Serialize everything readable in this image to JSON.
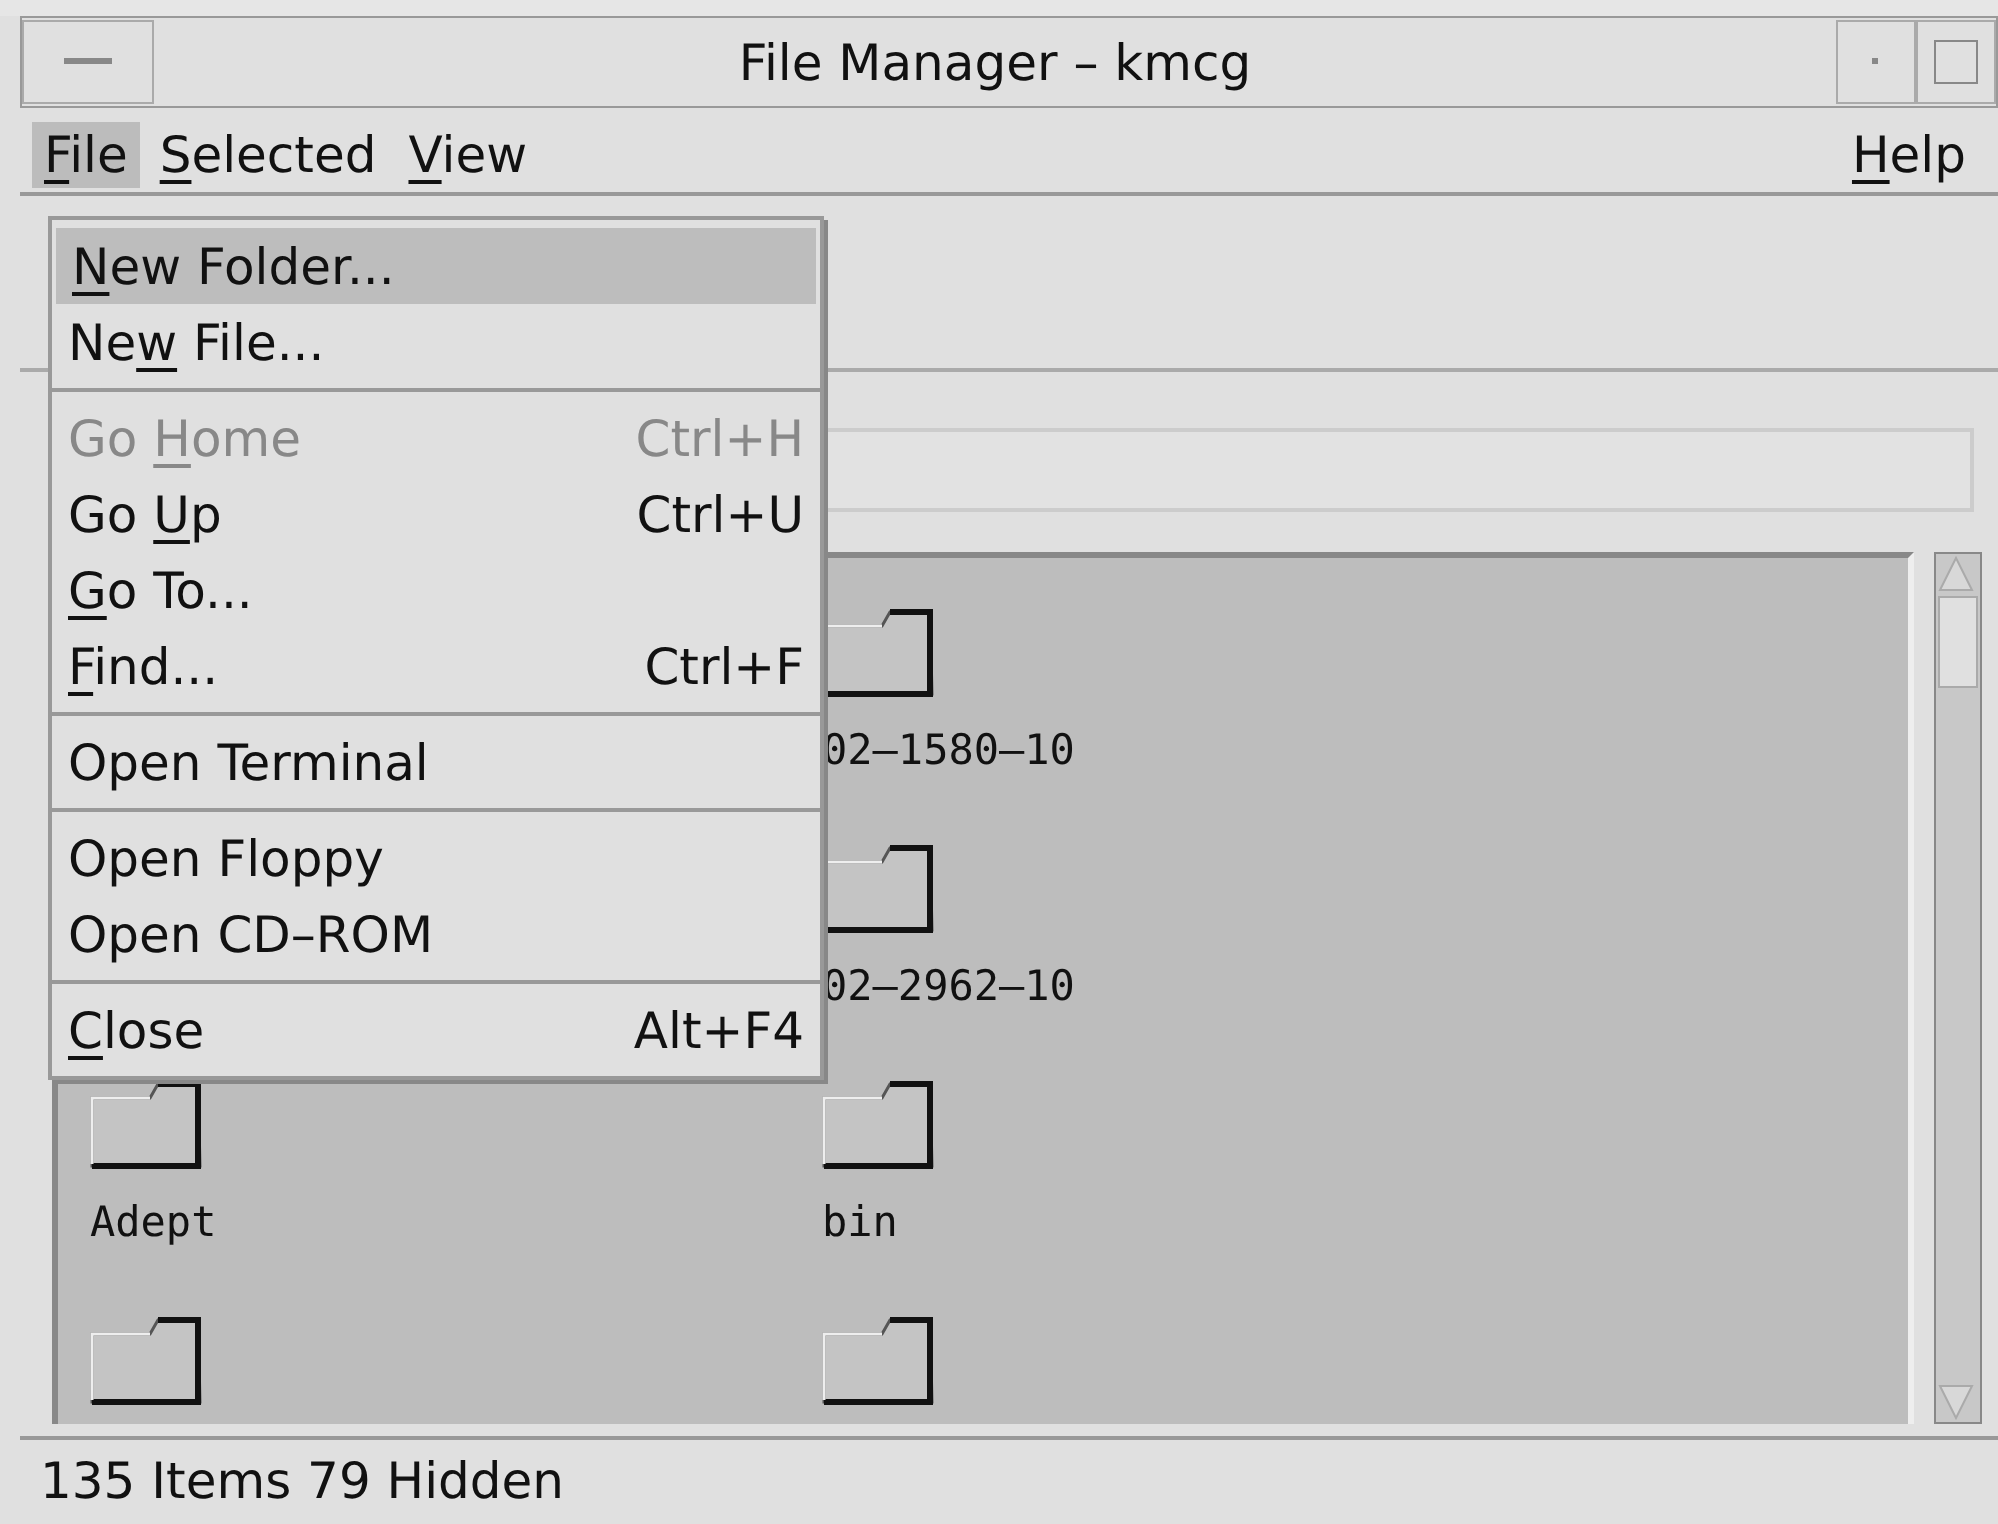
{
  "window": {
    "title": "File Manager – kmcg"
  },
  "menubar": [
    {
      "parts": [
        {
          "text": "F",
          "underlined": true
        },
        {
          "text": "ile",
          "underlined": false
        }
      ],
      "selected": true
    },
    {
      "parts": [
        {
          "text": "S",
          "underlined": true
        },
        {
          "text": "elected",
          "underlined": false
        }
      ],
      "selected": false
    },
    {
      "parts": [
        {
          "text": "V",
          "underlined": true
        },
        {
          "text": "iew",
          "underlined": false
        }
      ],
      "selected": false
    },
    {
      "parts": [
        {
          "text": "H",
          "underlined": true
        },
        {
          "text": "elp",
          "underlined": false
        }
      ],
      "selected": false,
      "kind": "right"
    }
  ],
  "file_menu": [
    {
      "kind": "item",
      "parts": [
        {
          "text": "N",
          "underlined": true
        },
        {
          "text": "ew Folder...",
          "underlined": false
        }
      ],
      "selected": true,
      "disabled": false
    },
    {
      "kind": "item",
      "parts": [
        {
          "text": "Ne",
          "underlined": false
        },
        {
          "text": "w",
          "underlined": true
        },
        {
          "text": " File...",
          "underlined": false
        }
      ],
      "selected": false,
      "disabled": false
    },
    {
      "kind": "separator"
    },
    {
      "kind": "item",
      "parts": [
        {
          "text": "Go ",
          "underlined": false
        },
        {
          "text": "H",
          "underlined": true
        },
        {
          "text": "ome",
          "underlined": false
        }
      ],
      "shortcut": "Ctrl+H",
      "selected": false,
      "disabled": true
    },
    {
      "kind": "item",
      "parts": [
        {
          "text": "Go ",
          "underlined": false
        },
        {
          "text": "U",
          "underlined": true
        },
        {
          "text": "p",
          "underlined": false
        }
      ],
      "shortcut": "Ctrl+U",
      "selected": false,
      "disabled": false
    },
    {
      "kind": "item",
      "parts": [
        {
          "text": "G",
          "underlined": true
        },
        {
          "text": "o To...",
          "underlined": false
        }
      ],
      "selected": false,
      "disabled": false
    },
    {
      "kind": "item",
      "parts": [
        {
          "text": "F",
          "underlined": true
        },
        {
          "text": "ind...",
          "underlined": false
        }
      ],
      "shortcut": "Ctrl+F",
      "selected": false,
      "disabled": false
    },
    {
      "kind": "separator"
    },
    {
      "kind": "item",
      "parts": [
        {
          "text": "Open Terminal",
          "underlined": false
        }
      ],
      "selected": false,
      "disabled": false
    },
    {
      "kind": "separator"
    },
    {
      "kind": "item",
      "parts": [
        {
          "text": "Open Floppy",
          "underlined": false
        }
      ],
      "selected": false,
      "disabled": false
    },
    {
      "kind": "item",
      "parts": [
        {
          "text": "Open CD–ROM",
          "underlined": false
        }
      ],
      "selected": false,
      "disabled": false
    },
    {
      "kind": "separator"
    },
    {
      "kind": "item",
      "parts": [
        {
          "text": "C",
          "underlined": true
        },
        {
          "text": "lose",
          "underlined": false
        }
      ],
      "shortcut": "Alt+F4",
      "selected": false,
      "disabled": false
    }
  ],
  "file_rows": [
    {
      "column_2": {
        "kind": "folder",
        "label": "02–1580–10"
      }
    },
    {
      "column_2": {
        "kind": "folder",
        "label": "02–2962–10"
      }
    },
    {
      "column_1": {
        "kind": "folder",
        "label": "Adept"
      },
      "column_2": {
        "kind": "folder",
        "label": "bin"
      }
    },
    {
      "column_1": {
        "kind": "folder"
      },
      "column_2": {
        "kind": "folder"
      }
    }
  ],
  "status_bar": "135 Items 79 Hidden"
}
